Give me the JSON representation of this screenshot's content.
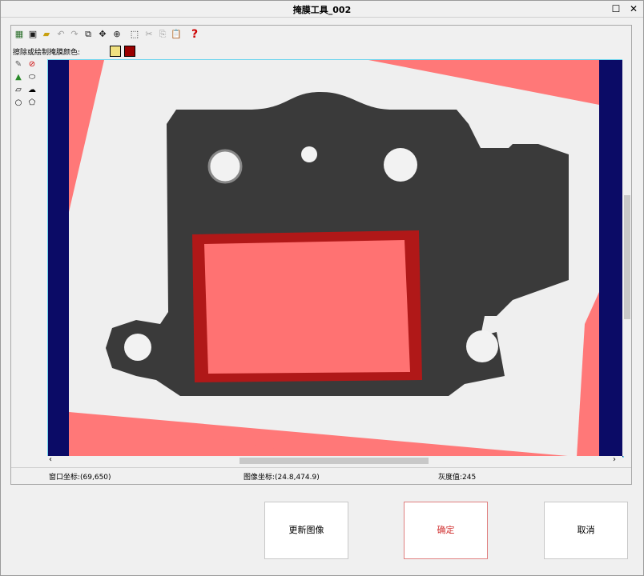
{
  "window": {
    "title": "掩膜工具_002",
    "maximize_glyph": "☐",
    "close_glyph": "✕"
  },
  "toolbar": {
    "tools": [
      {
        "name": "new-mask-icon",
        "glyph": "▦",
        "color": "#2a6e2a"
      },
      {
        "name": "save-icon",
        "glyph": "▣",
        "color": "#1a1a1a"
      },
      {
        "name": "open-folder-icon",
        "glyph": "▰",
        "color": "#c8a010"
      },
      {
        "name": "undo-icon",
        "glyph": "↶",
        "color": "#a0a0a0"
      },
      {
        "name": "redo-icon",
        "glyph": "↷",
        "color": "#a0a0a0"
      },
      {
        "name": "copy-region-icon",
        "glyph": "⧉",
        "color": "#1a1a1a"
      },
      {
        "name": "move-icon",
        "glyph": "✥",
        "color": "#1a1a1a"
      },
      {
        "name": "zoom-icon",
        "glyph": "⊕",
        "color": "#1a1a1a"
      },
      {
        "name": "select-rect-icon",
        "glyph": "⬚",
        "color": "#1a1a1a"
      },
      {
        "name": "cut-icon",
        "glyph": "✂",
        "color": "#a0a0a0"
      },
      {
        "name": "copy-icon",
        "glyph": "⎘",
        "color": "#a0a0a0"
      },
      {
        "name": "paste-icon",
        "glyph": "📋",
        "color": "#a0a0a0"
      },
      {
        "name": "help-icon",
        "glyph": "?",
        "color": "#cc0000"
      }
    ]
  },
  "colorbar": {
    "label": "擦除或绘制掩膜颜色:",
    "eraser_color": "#f0e080",
    "mask_color": "#9a0000"
  },
  "side_tools": [
    {
      "name": "brush-icon",
      "glyph": "✎",
      "color": "#555555"
    },
    {
      "name": "clear-icon",
      "glyph": "⊘",
      "color": "#cc0000"
    },
    {
      "name": "pen-icon",
      "glyph": "▲",
      "color": "#2a8a2a"
    },
    {
      "name": "ellipse-tool-icon",
      "glyph": "⬭",
      "color": "#000000"
    },
    {
      "name": "parallelogram-tool-icon",
      "glyph": "▱",
      "color": "#000000"
    },
    {
      "name": "freeform-tool-icon",
      "glyph": "☁",
      "color": "#000000"
    },
    {
      "name": "circle-tool-icon",
      "glyph": "○",
      "color": "#000000"
    },
    {
      "name": "polygon-tool-icon",
      "glyph": "⬠",
      "color": "#000000"
    }
  ],
  "status": {
    "window_coord": "窗口坐标:(69,650)",
    "image_coord": "图像坐标:(24.8,474.9)",
    "gray_value": "灰度值:245"
  },
  "buttons": {
    "update_image": "更新图像",
    "confirm": "确定",
    "cancel": "取消"
  },
  "colors": {
    "viewport_bg": "#0b0b66",
    "mask_fill": "#ff6e6e",
    "part_dark": "#3a3a3a"
  }
}
